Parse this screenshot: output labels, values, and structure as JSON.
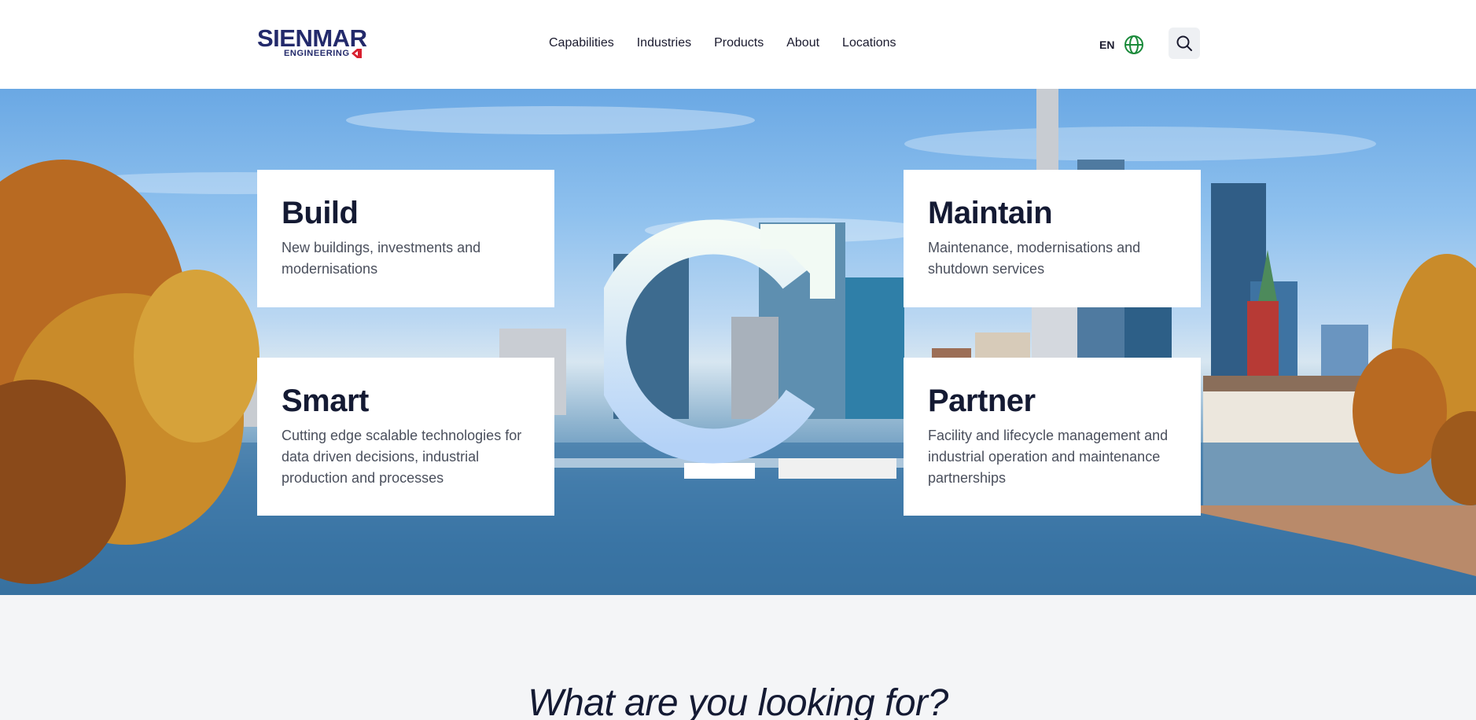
{
  "brand": {
    "name_top": "SIENMAR",
    "name_bottom": "ENGINEERING",
    "primary_color": "#232a6b",
    "accent_color": "#d8202f"
  },
  "nav": {
    "items": [
      {
        "label": "Capabilities"
      },
      {
        "label": "Industries"
      },
      {
        "label": "Products"
      },
      {
        "label": "About"
      },
      {
        "label": "Locations"
      }
    ]
  },
  "header": {
    "language": "EN",
    "language_icon": "globe-icon",
    "search_icon": "search-icon",
    "globe_color": "#1a8a3a"
  },
  "hero": {
    "cards": [
      {
        "title": "Build",
        "description": "New buildings, investments and modernisations"
      },
      {
        "title": "Maintain",
        "description": "Maintenance, modernisations and shutdown services"
      },
      {
        "title": "Smart",
        "description": "Cutting edge scalable technologies for data driven decisions, industrial production and processes"
      },
      {
        "title": "Partner",
        "description": "Facility and lifecycle management and industrial operation and maintenance partnerships"
      }
    ],
    "center_icon": "cycle-arrow-icon"
  },
  "section": {
    "heading": "What are you looking for?"
  }
}
